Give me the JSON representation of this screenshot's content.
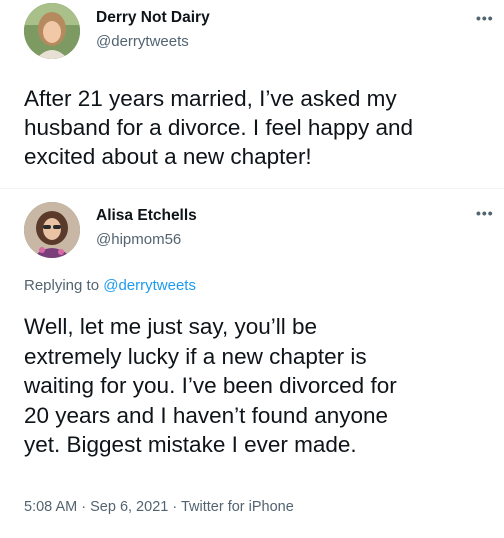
{
  "original": {
    "name": "Derry Not Dairy",
    "handle": "@derrytweets",
    "more": "•••",
    "lines": [
      "After 21 years married, I’ve asked my",
      "husband for a divorce. I feel happy and",
      "excited about a new chapter!"
    ]
  },
  "reply": {
    "name": "Alisa Etchells",
    "handle": "@hipmom56",
    "more": "•••",
    "replying_prefix": "Replying to",
    "replying_to": "@derrytweets",
    "lines": [
      "Well, let me just say, you’ll be",
      "extremely lucky if a new chapter is",
      "waiting for you. I’ve been divorced for",
      "20 years and I haven’t found anyone",
      "yet. Biggest mistake I ever made."
    ],
    "time": "5:08 AM",
    "separator": "·",
    "date": "Sep 6, 2021",
    "source": "Twitter for iPhone"
  },
  "colors": {
    "text": "#0f1419",
    "secondary": "#536471",
    "link": "#1d9bf0"
  }
}
